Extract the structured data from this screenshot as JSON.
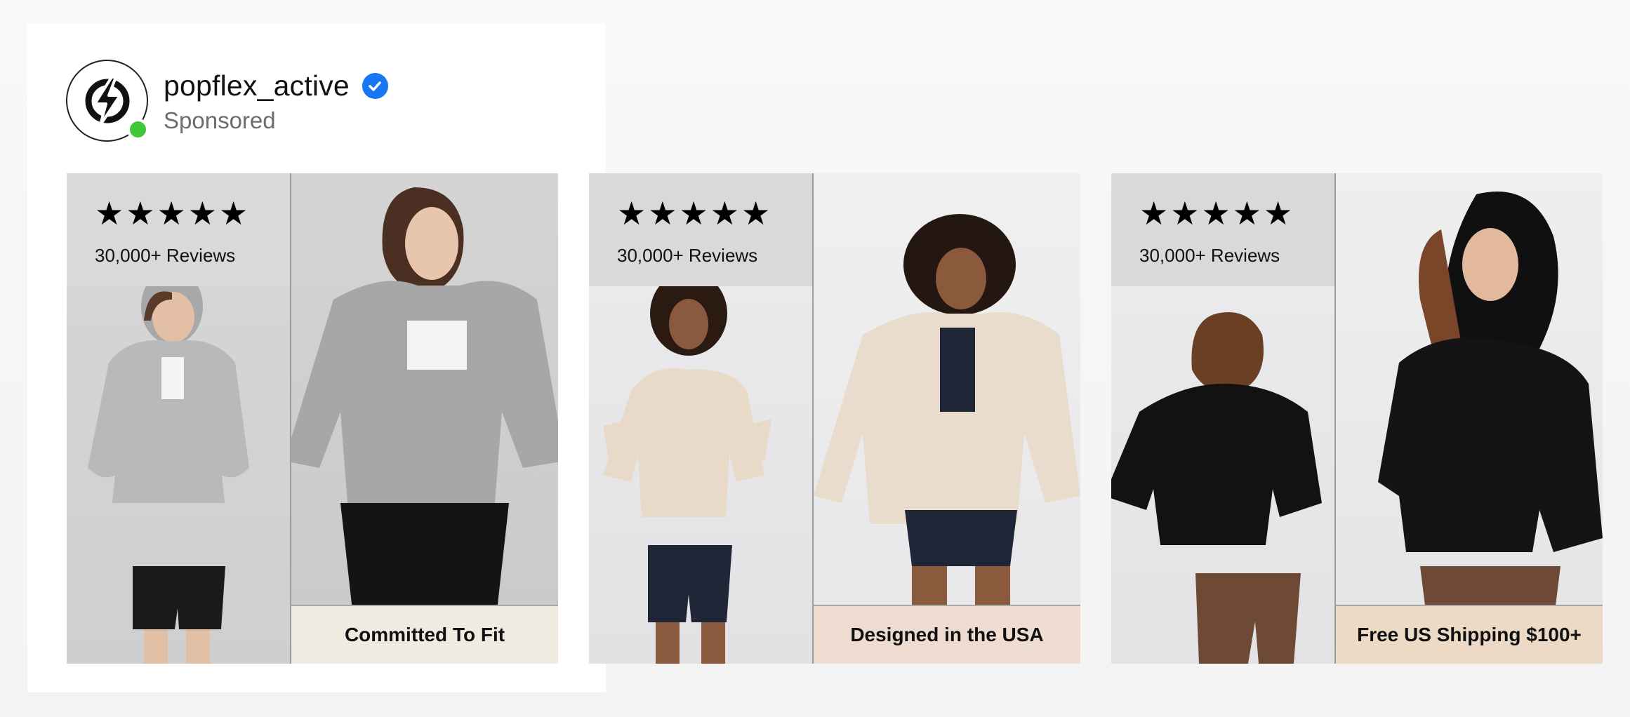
{
  "post": {
    "username": "popflex_active",
    "sponsored_label": "Sponsored",
    "avatar_icon": "lightning-bolt-icon",
    "verified_icon": "verified-check-icon",
    "online_status_color": "#3fc83a",
    "verified_color": "#1877f2"
  },
  "carousel": [
    {
      "stars": "★★★★★",
      "reviews": "30,000+ Reviews",
      "caption": "Committed To Fit",
      "caption_bg": "#efebe0",
      "hoodie_color": "#b4b4b6"
    },
    {
      "stars": "★★★★★",
      "reviews": "30,000+ Reviews",
      "caption": "Designed in the USA",
      "caption_bg": "#efdcd0",
      "hoodie_color": "#eadccb"
    },
    {
      "stars": "★★★★★",
      "reviews": "30,000+ Reviews",
      "caption": "Free US Shipping $100+",
      "caption_bg": "#ecdac6",
      "hoodie_color": "#141414"
    }
  ]
}
